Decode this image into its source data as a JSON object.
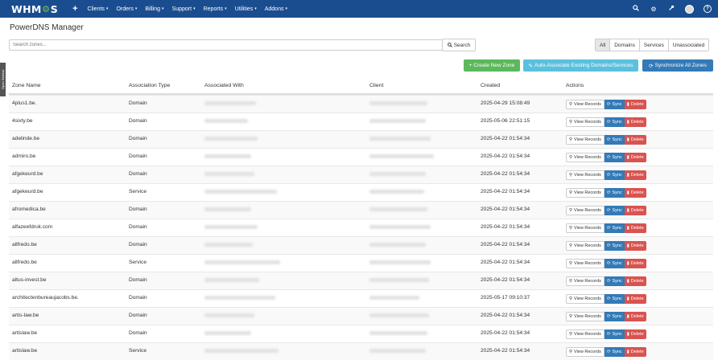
{
  "navbar": {
    "logo": "WHMCS",
    "items": [
      "Clients",
      "Orders",
      "Billing",
      "Support",
      "Reports",
      "Utilities",
      "Addons"
    ]
  },
  "side_tab": "Open Sidebar",
  "page_title": "PowerDNS Manager",
  "search": {
    "placeholder": "Search zones...",
    "button_label": "Search"
  },
  "filters": [
    "All",
    "Domains",
    "Services",
    "Unassociated"
  ],
  "actions": {
    "create": "Create New Zone",
    "auto_associate": "Auto-Associate Existing Domains/Services",
    "sync_all": "Synchronize All Zones"
  },
  "table": {
    "columns": [
      "Zone Name",
      "Association Type",
      "Associated With",
      "Client",
      "Created",
      "Actions"
    ],
    "row_buttons": {
      "view": "View Records",
      "sync": "Sync",
      "delete": "Delete"
    },
    "rows": [
      {
        "zone": "4plus1.be.",
        "type": "Domain",
        "created": "2025-04-29 15:08:49"
      },
      {
        "zone": "4sixty.be",
        "type": "Domain",
        "created": "2025-05-06 22:51:15"
      },
      {
        "zone": "adelinde.be",
        "type": "Domain",
        "created": "2025-04-22 01:54:34"
      },
      {
        "zone": "admiro.be",
        "type": "Domain",
        "created": "2025-04-22 01:54:34"
      },
      {
        "zone": "afgekeurd.be",
        "type": "Domain",
        "created": "2025-04-22 01:54:34"
      },
      {
        "zone": "afgekeurd.be",
        "type": "Service",
        "created": "2025-04-22 01:54:34"
      },
      {
        "zone": "afromedica.be",
        "type": "Domain",
        "created": "2025-04-22 01:54:34"
      },
      {
        "zone": "alfazeefdruk.com",
        "type": "Domain",
        "created": "2025-04-22 01:54:34"
      },
      {
        "zone": "allfredo.be",
        "type": "Domain",
        "created": "2025-04-22 01:54:34"
      },
      {
        "zone": "allfredo.be",
        "type": "Service",
        "created": "2025-04-22 01:54:34"
      },
      {
        "zone": "altus-invest.be",
        "type": "Domain",
        "created": "2025-04-22 01:54:34"
      },
      {
        "zone": "architectenbureaujacobs.be.",
        "type": "Domain",
        "created": "2025-05-17 09:10:37"
      },
      {
        "zone": "artis-law.be",
        "type": "Domain",
        "created": "2025-04-22 01:54:34"
      },
      {
        "zone": "artislaw.be",
        "type": "Domain",
        "created": "2025-04-22 01:54:34"
      },
      {
        "zone": "artislaw.be",
        "type": "Service",
        "created": "2025-04-22 01:54:34"
      }
    ]
  },
  "colors": {
    "navbar": "#1a4d8f",
    "success": "#5cb85c",
    "info": "#5bc0de",
    "primary": "#337ab7",
    "danger": "#d9534f"
  },
  "icons": [
    "plus-icon",
    "search-icon",
    "magic-icon",
    "sync-icon",
    "trash-icon",
    "cogs-icon",
    "wrench-icon",
    "help-icon"
  ]
}
